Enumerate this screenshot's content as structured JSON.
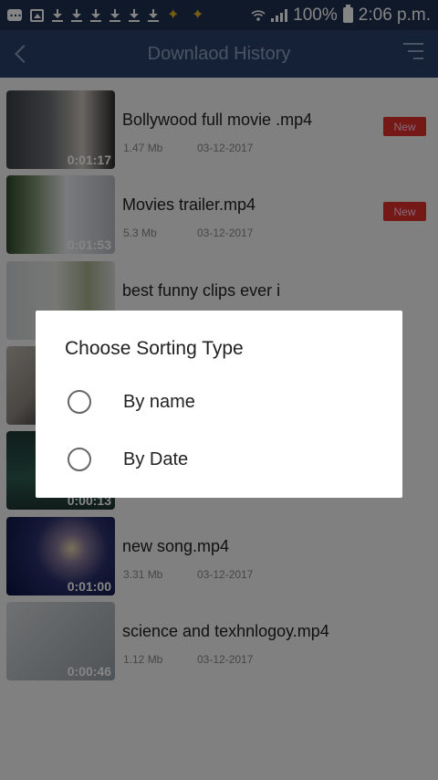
{
  "status_bar": {
    "battery": "100%",
    "time": "2:06 p.m."
  },
  "header": {
    "title": "Downlaod History",
    "back_icon": "chevron-left-icon",
    "menu_icon": "sort-menu-icon"
  },
  "videos": [
    {
      "title": "Bollywood full movie .mp4",
      "size": "1.47 Mb",
      "date": "03-12-2017",
      "duration": "0:01:17",
      "badge": "New"
    },
    {
      "title": "Movies trailer.mp4",
      "size": "5.3 Mb",
      "date": "03-12-2017",
      "duration": "0:01:53",
      "badge": "New"
    },
    {
      "title": "best funny clips ever i",
      "duration": ""
    },
    {
      "title": "",
      "duration": ""
    },
    {
      "title": "",
      "duration": "0:00:13"
    },
    {
      "title": "new song.mp4",
      "size": "3.31 Mb",
      "date": "03-12-2017",
      "duration": "0:01:00"
    },
    {
      "title": "science and texhnlogoy.mp4",
      "size": "1.12 Mb",
      "date": "03-12-2017",
      "duration": "0:00:46"
    }
  ],
  "dialog": {
    "title": "Choose Sorting Type",
    "options": [
      {
        "label": "By name",
        "selected": false
      },
      {
        "label": "By Date",
        "selected": false
      }
    ]
  },
  "colors": {
    "status_bar": "#1f3050",
    "header": "#2a4068",
    "header_text": "#8da2c2",
    "badge": "#e0302c"
  }
}
